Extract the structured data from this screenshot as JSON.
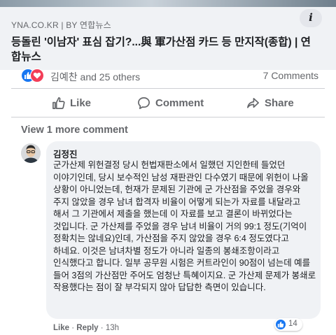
{
  "link_preview": {
    "source": "YNA.CO.KR | BY 연합뉴스",
    "headline": "등돌린 '이남자' 표심 잡기?...與 軍가산점 카드 등 만지작(종합) | 연합뉴스",
    "info_icon": "info-icon"
  },
  "reactions": {
    "names": "김예찬 and 25 others",
    "comment_count": "7 Comments",
    "icons": [
      "like-icon",
      "love-icon"
    ],
    "like_color": "#1877f2",
    "love_color": "#f33e58"
  },
  "actions": {
    "like": "Like",
    "comment": "Comment",
    "share": "Share"
  },
  "view_more": "View 1 more comment",
  "comment": {
    "author": "김정진",
    "text": "군가산제 위헌결정 당시 헌법재판소에서 일했던 지인한테 들었던 이야기인데, 당시 보수적인 남성 재판관인 다수였기 때문에 위헌이 나올 상황이 아니었는데, 헌재가 문제된 기관에 군 가산점을 주었을 경우와 주지 않았을 경우 남녀 합격자 비율이 어떻게 되는가 자료를 내달라고 해서 그 기관에서 제출을 했는데 이 자료를 보고 결론이 바뀌었다는 것입니다. 군 가산제를 주었을 경우 남녀 비율이 거의 99:1 정도(기억이 정확치는 않네요)인데, 가산점을 주지 않았을 경우 6:4 정도였다고 하네요. 이것은 남녀차별 정도가 아니라 일종의 봉쇄조항이라고 인식했다고 합니다. 일부 공무원 시험은 커트라인이 90점이 넘는데 예를 들어 3점의 가산점만 주어도 엄청난 특혜이지요. 군 가산제 문제가 봉쇄로 작용했다는 점이 잘 부각되지 않아 답답한 측면이 있습니다.",
    "like": "Like",
    "reply": "Reply",
    "separator": "·",
    "time": "13h",
    "reaction_count": "14"
  }
}
